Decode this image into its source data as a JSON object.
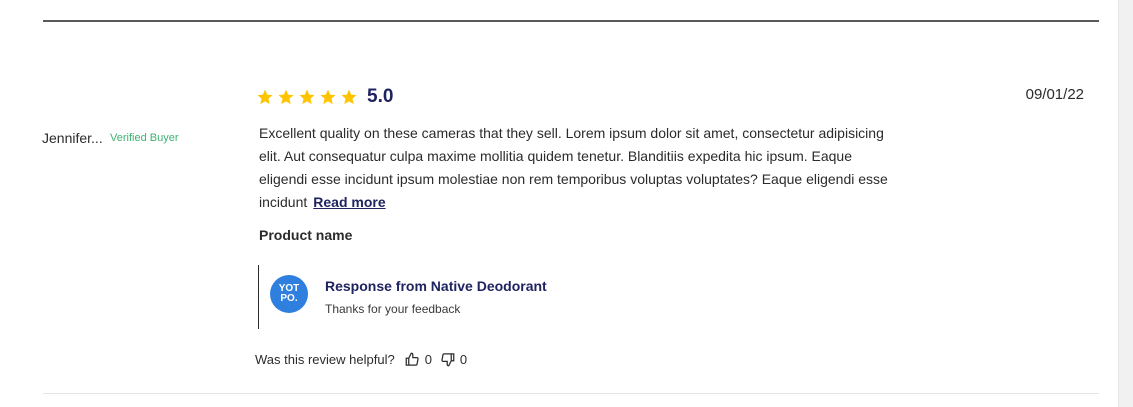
{
  "review": {
    "author": "Jennifer...",
    "badge": "Verified Buyer",
    "rating_value": 5,
    "rating_text": "5.0",
    "date": "09/01/22",
    "body": "Excellent quality on these cameras that they sell. Lorem ipsum dolor sit amet, consectetur adipisicing elit. Aut consequatur culpa maxime mollitia quidem tenetur. Blanditiis expedita hic ipsum. Eaque eligendi esse incidunt ipsum molestiae non rem temporibus voluptas voluptates?  Eaque eligendi esse incidunt",
    "read_more": "Read more",
    "product_name": "Product name"
  },
  "response": {
    "logo_text": "YOT PO.",
    "title": "Response from Native Deodorant",
    "body": "Thanks for your feedback"
  },
  "helpful": {
    "question": "Was this review helpful?",
    "upvotes": "0",
    "downvotes": "0"
  },
  "colors": {
    "star": "#ffc400",
    "accent": "#1f2461",
    "verified": "#3cb371",
    "logo_bg": "#2f7fdf"
  }
}
